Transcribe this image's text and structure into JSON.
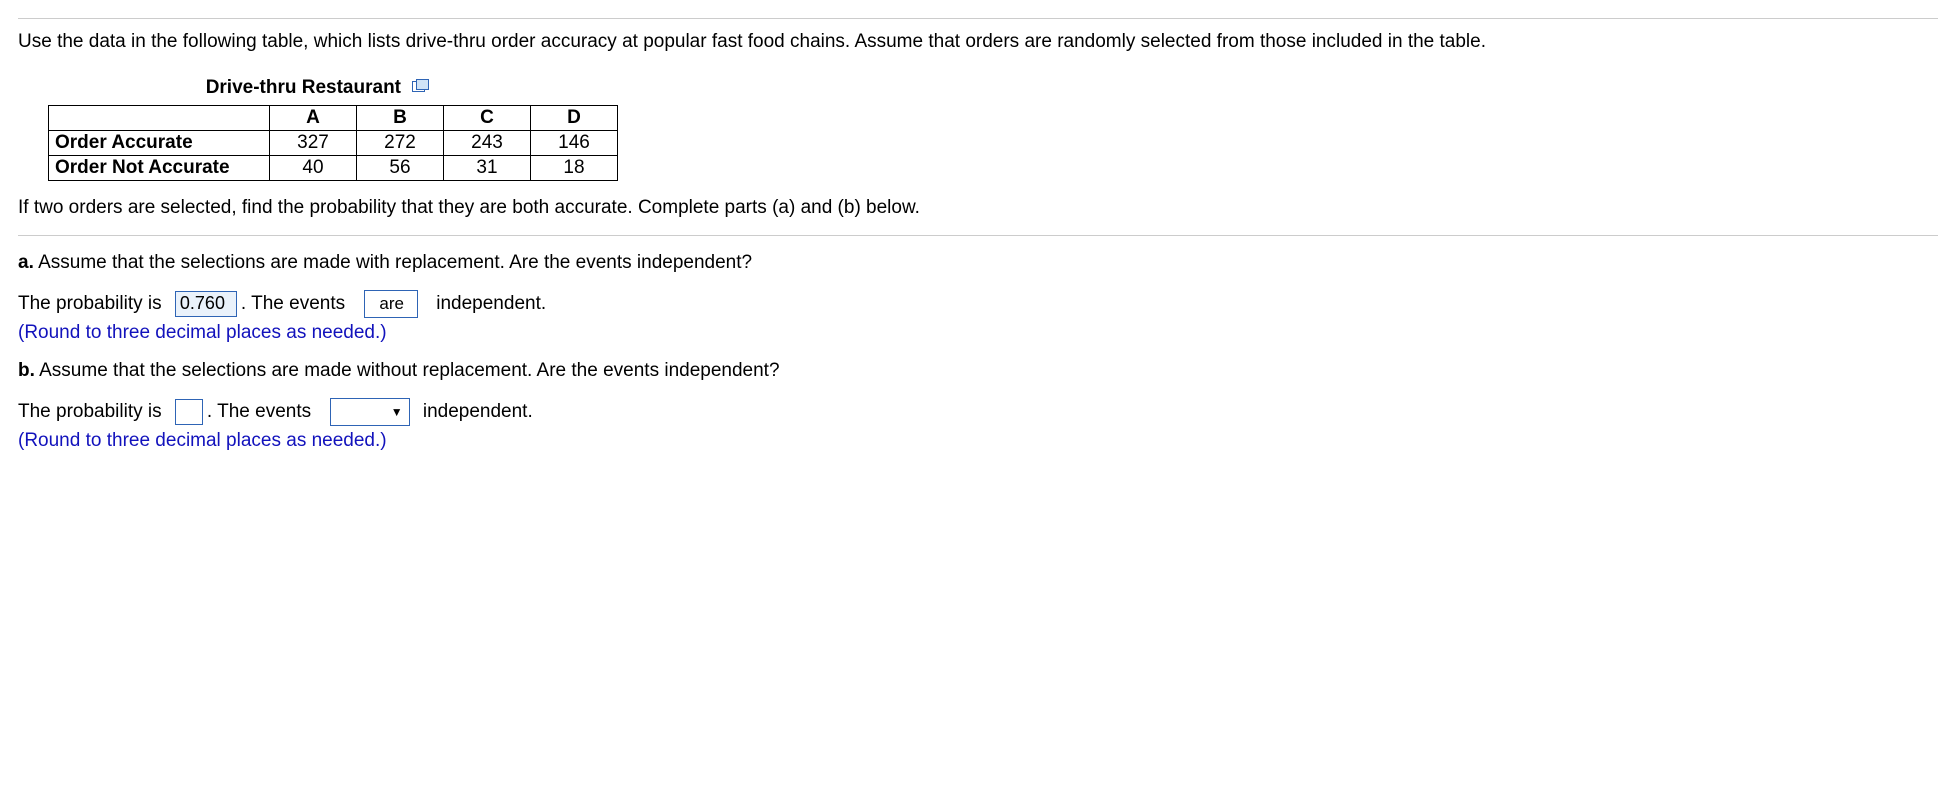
{
  "intro": "Use the data in the following table, which lists drive-thru order accuracy at popular fast food chains. Assume that orders are randomly selected from those included in the table.",
  "table": {
    "title": "Drive-thru Restaurant",
    "columns": [
      "A",
      "B",
      "C",
      "D"
    ],
    "rows": [
      {
        "label": "Order Accurate",
        "values": [
          "327",
          "272",
          "243",
          "146"
        ]
      },
      {
        "label": "Order Not Accurate",
        "values": [
          "40",
          "56",
          "31",
          "18"
        ]
      }
    ]
  },
  "question_main": "If two orders are selected, find the probability that they are both accurate. Complete parts (a) and (b) below.",
  "part_a": {
    "label": "a.",
    "text": "Assume that the selections are made with replacement. Are the events independent?",
    "line_prefix": "The probability is",
    "value": "0.760",
    "after_value": ". The events",
    "select_value": "are",
    "after_select": "independent.",
    "hint": "(Round to three decimal places as needed.)"
  },
  "part_b": {
    "label": "b.",
    "text": "Assume that the selections are made without replacement. Are the events independent?",
    "line_prefix": "The probability is",
    "value": "",
    "after_value": ". The events",
    "select_value": "",
    "after_select": "independent.",
    "hint": "(Round to three decimal places as needed.)"
  },
  "icons": {
    "popup": "popup-icon",
    "caret": "▼"
  },
  "chart_data": {
    "type": "table",
    "title": "Drive-thru Restaurant",
    "columns": [
      "",
      "A",
      "B",
      "C",
      "D"
    ],
    "rows": [
      [
        "Order Accurate",
        327,
        272,
        243,
        146
      ],
      [
        "Order Not Accurate",
        40,
        56,
        31,
        18
      ]
    ]
  }
}
